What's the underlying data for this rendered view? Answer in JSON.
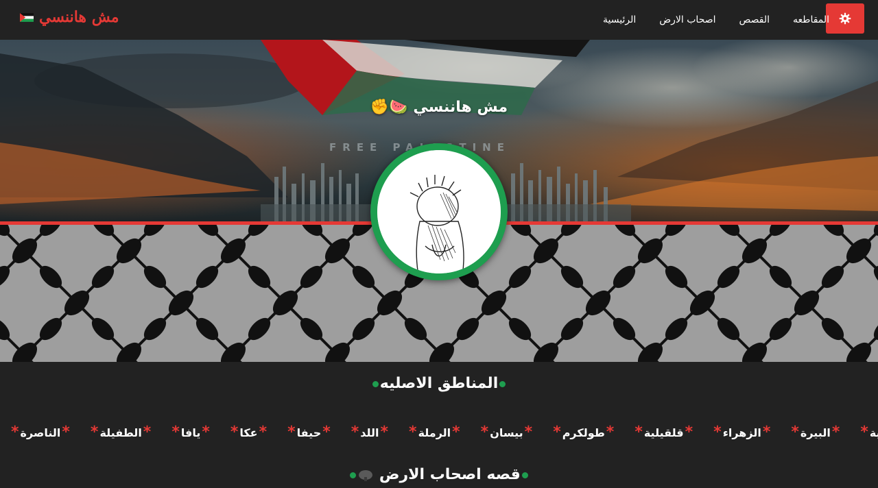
{
  "brand": {
    "title": "مش هاننسي",
    "flag_icon": "palestine-flag-icon"
  },
  "nav": {
    "settings_icon": "gear-icon",
    "links": [
      "المقاطعه",
      "القصص",
      "اصحاب الارض",
      "الرئيسية"
    ]
  },
  "hero": {
    "title": "مش هاننسي 🍉✊",
    "watermark": "FREE PALESTINE"
  },
  "sections": {
    "regions_title": "المناطق الاصليه",
    "regions": [
      "الناصرة",
      "الطفيلة",
      "يافا",
      "عكا",
      "حيفا",
      "اللد",
      "الرملة",
      "بيسان",
      "طولكرم",
      "قلقيلية",
      "الزهراء",
      "البيرة",
      "عية"
    ],
    "story_title": "قصه اصحاب الارض"
  },
  "colors": {
    "accent": "#e53935",
    "green": "#1e9e4f",
    "background": "#222222"
  }
}
